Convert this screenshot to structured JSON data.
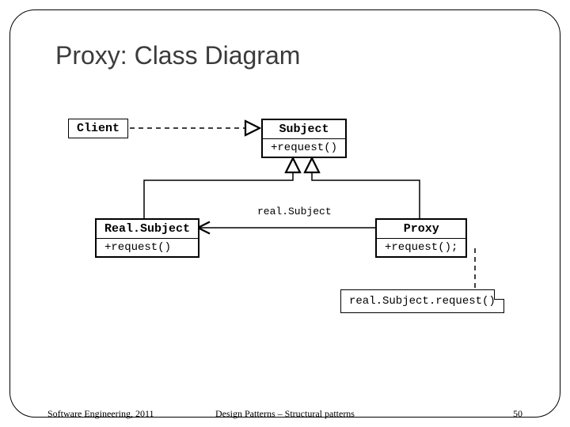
{
  "slide": {
    "title": "Proxy: Class Diagram"
  },
  "classes": {
    "client": {
      "name": "Client"
    },
    "subject": {
      "name": "Subject",
      "op": "+request()"
    },
    "realsubject": {
      "name": "Real.Subject",
      "op": "+request()"
    },
    "proxy": {
      "name": "Proxy",
      "op": "+request();"
    }
  },
  "assoc_label": "real.Subject",
  "note": {
    "body": "real.Subject.request()"
  },
  "footer": {
    "left": "Software Engineering, 2011",
    "center": "Design Patterns – Structural patterns",
    "page": "50"
  }
}
